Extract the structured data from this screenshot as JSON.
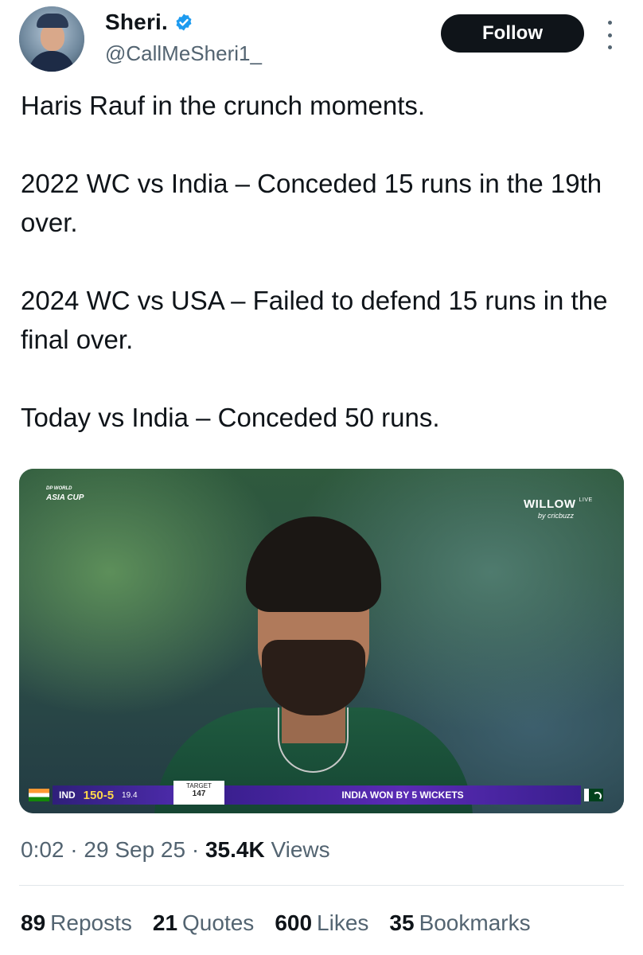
{
  "author": {
    "display_name": "Sheri.",
    "handle": "@CallMeSheri1_",
    "verified": true,
    "verified_color": "#1d9bf0"
  },
  "follow_button": {
    "label": "Follow"
  },
  "tweet": {
    "lines": [
      "Haris Rauf in the crunch moments.",
      "2022 WC vs India – Conceded 15 runs in the 19th over.",
      "2024 WC vs USA – Failed to defend 15 runs in the final over.",
      "Today vs India – Conceded 50 runs."
    ]
  },
  "media": {
    "broadcast_logo": "WILLOW",
    "broadcast_live": "LIVE",
    "broadcast_by": "by cricbuzz",
    "event_logo_top": "DP WORLD",
    "event_logo_main": "ASIA CUP",
    "scorebar": {
      "team": "IND",
      "score": "150-5",
      "overs": "19.4",
      "target_label": "TARGET",
      "target_value": "147",
      "result": "INDIA WON BY 5 WICKETS"
    }
  },
  "meta": {
    "time": "0:02",
    "date": "29 Sep 25",
    "views_count": "35.4K",
    "views_label": "Views"
  },
  "stats": {
    "reposts_count": "89",
    "reposts_label": "Reposts",
    "quotes_count": "21",
    "quotes_label": "Quotes",
    "likes_count": "600",
    "likes_label": "Likes",
    "bookmarks_count": "35",
    "bookmarks_label": "Bookmarks"
  }
}
